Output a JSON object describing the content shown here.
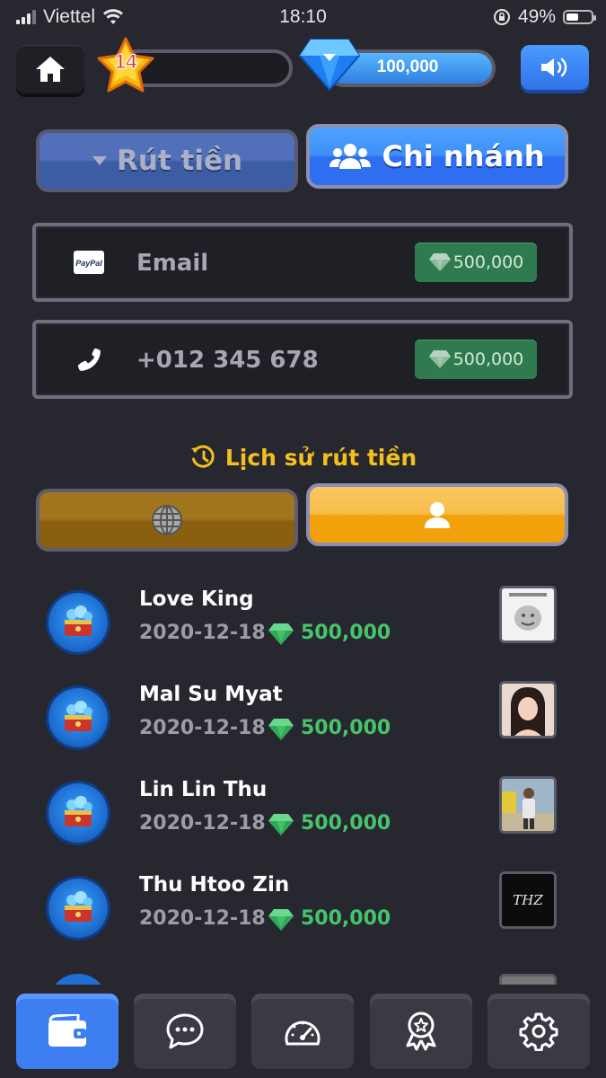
{
  "status_bar": {
    "carrier": "Viettel",
    "time": "18:10",
    "battery": "49%"
  },
  "top_bar": {
    "level": "14",
    "gems": "100,000"
  },
  "tabs": {
    "withdraw": "Rút tiền",
    "branch": "Chi nhánh"
  },
  "fields": [
    {
      "icon": "paypal-icon",
      "paypal_label": "PayPal",
      "text": "Email",
      "price": "500,000"
    },
    {
      "icon": "phone-icon",
      "text": "+012 345 678",
      "price": "500,000"
    }
  ],
  "history": {
    "title": "Lịch sử rút tiền",
    "rows": [
      {
        "name": "Love King",
        "date": "2020-12-18",
        "amount": "500,000"
      },
      {
        "name": "Mal Su Myat",
        "date": "2020-12-18",
        "amount": "500,000"
      },
      {
        "name": "Lin Lin Thu",
        "date": "2020-12-18",
        "amount": "500,000"
      },
      {
        "name": "Thu Htoo Zin",
        "date": "2020-12-18",
        "amount": "500,000"
      }
    ]
  },
  "thumb_text": {
    "row4": "THZ"
  },
  "colors": {
    "accent_blue": "#3d7ff0",
    "gold": "#f3c11b",
    "green": "#46c46b",
    "bg": "#27272f"
  },
  "nav_icons": [
    "wallet-icon",
    "chat-icon",
    "speedometer-icon",
    "award-icon",
    "gear-icon"
  ]
}
